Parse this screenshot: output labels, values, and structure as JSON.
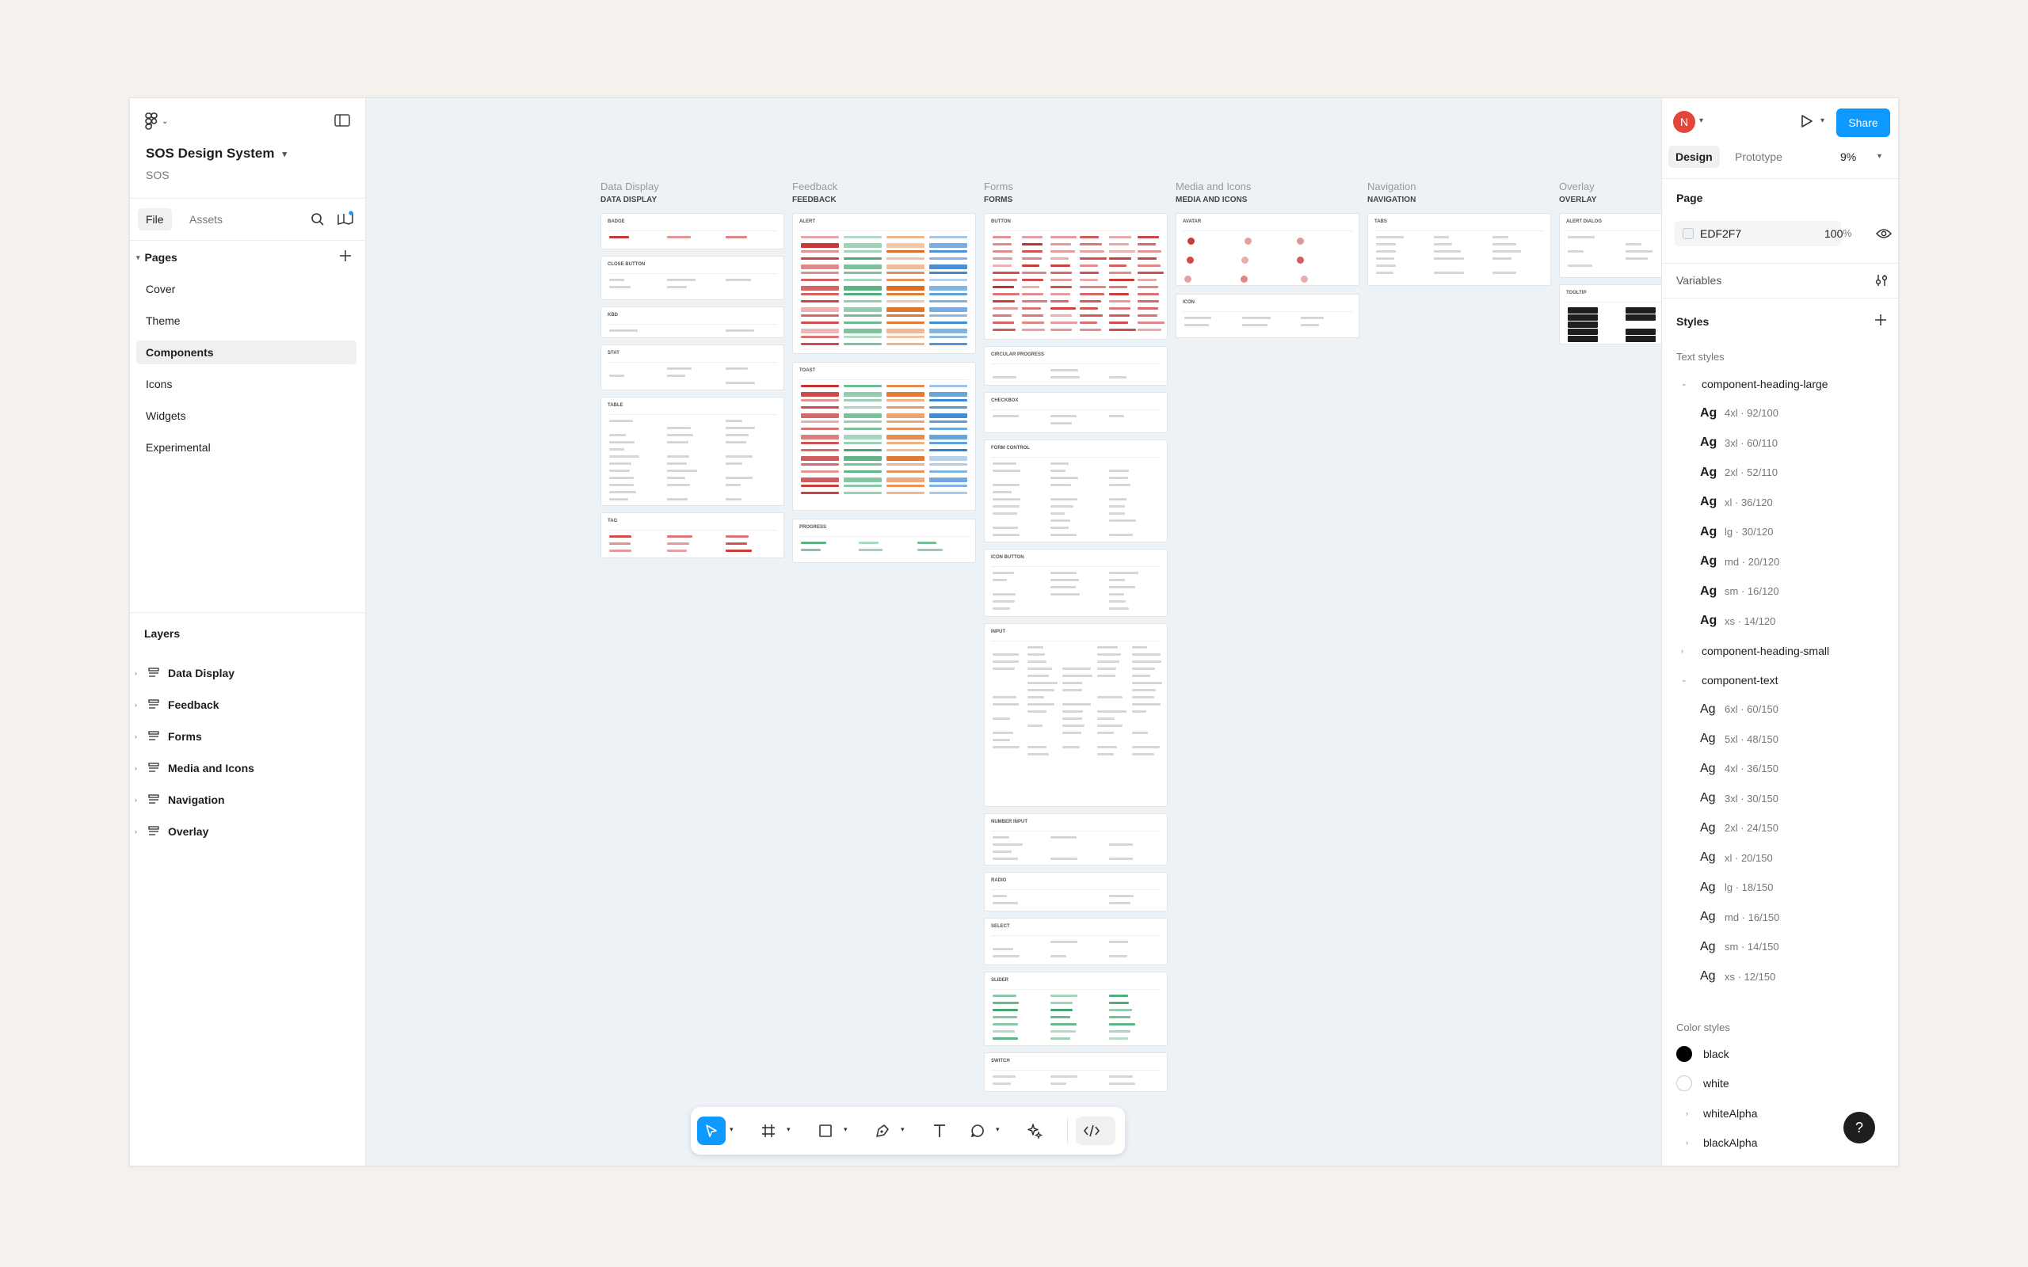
{
  "file": {
    "title": "SOS Design System",
    "subtitle": "SOS"
  },
  "left_tabs": {
    "file": "File",
    "assets": "Assets"
  },
  "pages": {
    "heading": "Pages",
    "items": [
      "Cover",
      "Theme",
      "Components",
      "Icons",
      "Widgets",
      "Experimental"
    ],
    "selected": "Components"
  },
  "layers": {
    "heading": "Layers",
    "items": [
      "Data Display",
      "Feedback",
      "Forms",
      "Media and Icons",
      "Navigation",
      "Overlay"
    ]
  },
  "right": {
    "avatar": "N",
    "share": "Share",
    "tabs": {
      "design": "Design",
      "prototype": "Prototype"
    },
    "zoom": "9%",
    "page": {
      "heading": "Page",
      "color": "EDF2F7",
      "opacity": "100",
      "pct": "%"
    },
    "variables": "Variables",
    "styles": "Styles",
    "text_styles_label": "Text styles",
    "color_styles_label": "Color styles",
    "text_groups": [
      {
        "name": "component-heading-large",
        "expanded": true,
        "bold": true,
        "items": [
          {
            "ag": "Ag",
            "label": "4xl · 92/100"
          },
          {
            "ag": "Ag",
            "label": "3xl · 60/110"
          },
          {
            "ag": "Ag",
            "label": "2xl · 52/110"
          },
          {
            "ag": "Ag",
            "label": "xl · 36/120"
          },
          {
            "ag": "Ag",
            "label": "lg · 30/120"
          },
          {
            "ag": "Ag",
            "label": "md · 20/120"
          },
          {
            "ag": "Ag",
            "label": "sm · 16/120"
          },
          {
            "ag": "Ag",
            "label": "xs · 14/120"
          }
        ]
      },
      {
        "name": "component-heading-small",
        "expanded": false,
        "bold": true,
        "items": []
      },
      {
        "name": "component-text",
        "expanded": true,
        "bold": false,
        "items": [
          {
            "ag": "Ag",
            "label": "6xl · 60/150"
          },
          {
            "ag": "Ag",
            "label": "5xl · 48/150"
          },
          {
            "ag": "Ag",
            "label": "4xl · 36/150"
          },
          {
            "ag": "Ag",
            "label": "3xl · 30/150"
          },
          {
            "ag": "Ag",
            "label": "2xl · 24/150"
          },
          {
            "ag": "Ag",
            "label": "xl · 20/150"
          },
          {
            "ag": "Ag",
            "label": "lg · 18/150"
          },
          {
            "ag": "Ag",
            "label": "md · 16/150"
          },
          {
            "ag": "Ag",
            "label": "sm · 14/150"
          },
          {
            "ag": "Ag",
            "label": "xs · 12/150"
          }
        ]
      }
    ],
    "color_styles": [
      {
        "name": "black",
        "swatch": "#000000"
      },
      {
        "name": "white",
        "swatch": "#ffffff"
      },
      {
        "name": "whiteAlpha",
        "group": true
      },
      {
        "name": "blackAlpha",
        "group": true
      }
    ],
    "help": "?"
  },
  "canvas": {
    "sections": [
      {
        "label": "Data Display",
        "label2": "DATA DISPLAY",
        "cards": [
          "BADGE",
          "CLOSE BUTTON",
          "KBD",
          "STAT",
          "TABLE",
          "TAG"
        ]
      },
      {
        "label": "Feedback",
        "label2": "FEEDBACK",
        "cards": [
          "ALERT",
          "TOAST",
          "PROGRESS"
        ]
      },
      {
        "label": "Forms",
        "label2": "FORMS",
        "cards": [
          "BUTTON",
          "CIRCULAR PROGRESS",
          "CHECKBOX",
          "FORM CONTROL",
          "ICON BUTTON",
          "INPUT",
          "NUMBER INPUT",
          "RADIO",
          "SELECT",
          "SLIDER",
          "SWITCH"
        ]
      },
      {
        "label": "Media and Icons",
        "label2": "MEDIA AND ICONS",
        "cards": [
          "AVATAR",
          "ICON"
        ]
      },
      {
        "label": "Navigation",
        "label2": "NAVIGATION",
        "cards": [
          "TABS"
        ]
      },
      {
        "label": "Overlay",
        "label2": "OVERLAY",
        "cards": [
          "ALERT DIALOG",
          "TOOLTIP"
        ]
      }
    ]
  },
  "colors": {
    "accent": "#0d99ff",
    "canvas": "#edf2f7",
    "red": "#c53030",
    "green": "#38a169",
    "orange": "#dd6b20",
    "blue": "#3182ce"
  },
  "icons": [
    "figma-logo-icon",
    "panel-toggle-icon",
    "search-icon",
    "library-icon",
    "plus-icon",
    "frame-icon",
    "eye-icon",
    "variables-icon",
    "play-icon",
    "move-icon",
    "frame-tool-icon",
    "rectangle-icon",
    "pen-icon",
    "text-icon",
    "comment-icon",
    "ai-icon",
    "dev-mode-icon"
  ]
}
